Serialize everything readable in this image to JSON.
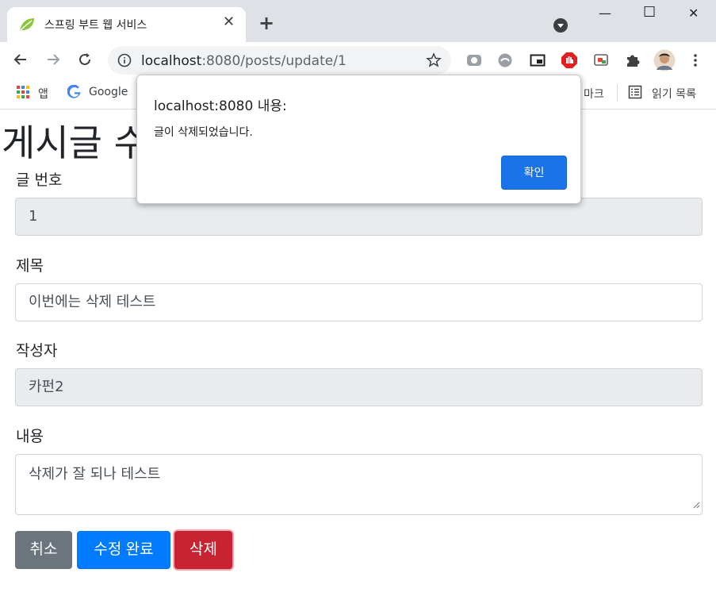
{
  "browser": {
    "tab_title": "스프링 부트 웹 서비스",
    "tab_close": "✕",
    "new_tab": "+",
    "window_controls": {
      "minimize": "—",
      "maximize": "☐",
      "close": "✕"
    },
    "url_host": "localhost",
    "url_rest": ":8080/posts/update/1",
    "bookmarks": {
      "apps": "앱",
      "google": "Google",
      "partial_bookmark": "마크",
      "reading_list": "읽기 목록"
    },
    "icons": [
      "back-icon",
      "forward-icon",
      "reload-icon",
      "info-icon",
      "star-icon",
      "extension-icons",
      "puzzle-icon",
      "avatar",
      "menu-icon"
    ]
  },
  "page": {
    "heading": "게시글 수",
    "fields": {
      "id_label": "글 번호",
      "id_value": "1",
      "title_label": "제목",
      "title_value": "이번에는 삭제 테스트",
      "author_label": "작성자",
      "author_value": "카펀2",
      "content_label": "내용",
      "content_value": "삭제가 잘 되나 테스트"
    },
    "buttons": {
      "cancel": "취소",
      "update": "수정 완료",
      "delete": "삭제"
    },
    "button_colors": {
      "cancel": "#6c757d",
      "update": "#007bff",
      "delete": "#c82333"
    }
  },
  "dialog": {
    "title": "localhost:8080 내용:",
    "message": "글이 삭제되었습니다.",
    "ok_label": "확인"
  }
}
